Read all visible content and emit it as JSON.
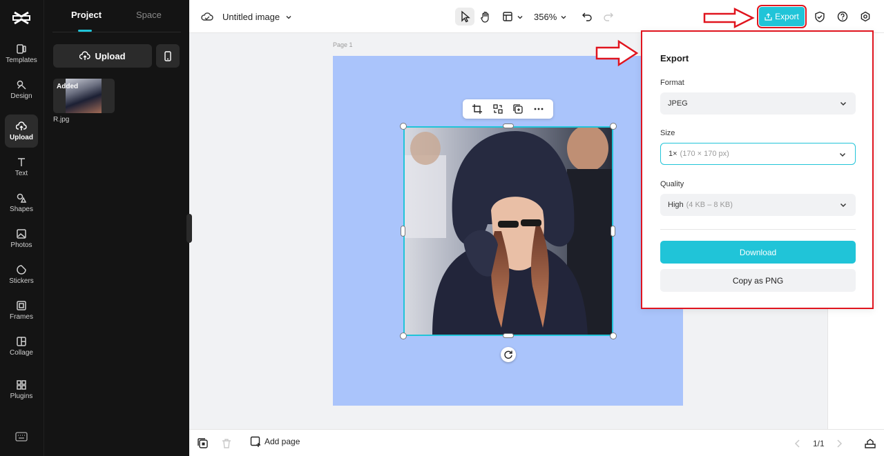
{
  "rail": {
    "items": [
      {
        "label": "Templates",
        "icon": "templates-icon"
      },
      {
        "label": "Design",
        "icon": "design-icon"
      },
      {
        "label": "Upload",
        "icon": "upload-icon"
      },
      {
        "label": "Text",
        "icon": "text-icon"
      },
      {
        "label": "Shapes",
        "icon": "shapes-icon"
      },
      {
        "label": "Photos",
        "icon": "photos-icon"
      },
      {
        "label": "Stickers",
        "icon": "stickers-icon"
      },
      {
        "label": "Frames",
        "icon": "frames-icon"
      },
      {
        "label": "Collage",
        "icon": "collage-icon"
      },
      {
        "label": "Plugins",
        "icon": "plugins-icon"
      }
    ],
    "active": "Upload"
  },
  "panel": {
    "tabs": [
      "Project",
      "Space"
    ],
    "upload_label": "Upload",
    "asset": {
      "badge": "Added",
      "name": "R.jpg"
    }
  },
  "topbar": {
    "title": "Untitled image",
    "zoom": "356%",
    "export_label": "Export"
  },
  "canvas": {
    "page_label": "Page 1",
    "page_color": "#aac4fb"
  },
  "export_panel": {
    "title": "Export",
    "format_label": "Format",
    "format_value": "JPEG",
    "size_label": "Size",
    "size_value": "1×",
    "size_hint": "(170 × 170 px)",
    "quality_label": "Quality",
    "quality_value": "High",
    "quality_hint": "(4 KB – 8 KB)",
    "download_label": "Download",
    "copy_label": "Copy as PNG"
  },
  "bottombar": {
    "add_page_label": "Add page",
    "page_count": "1/1"
  },
  "colors": {
    "accent": "#20c4d8",
    "annotation": "#e0141e",
    "rail_bg": "#141414"
  }
}
